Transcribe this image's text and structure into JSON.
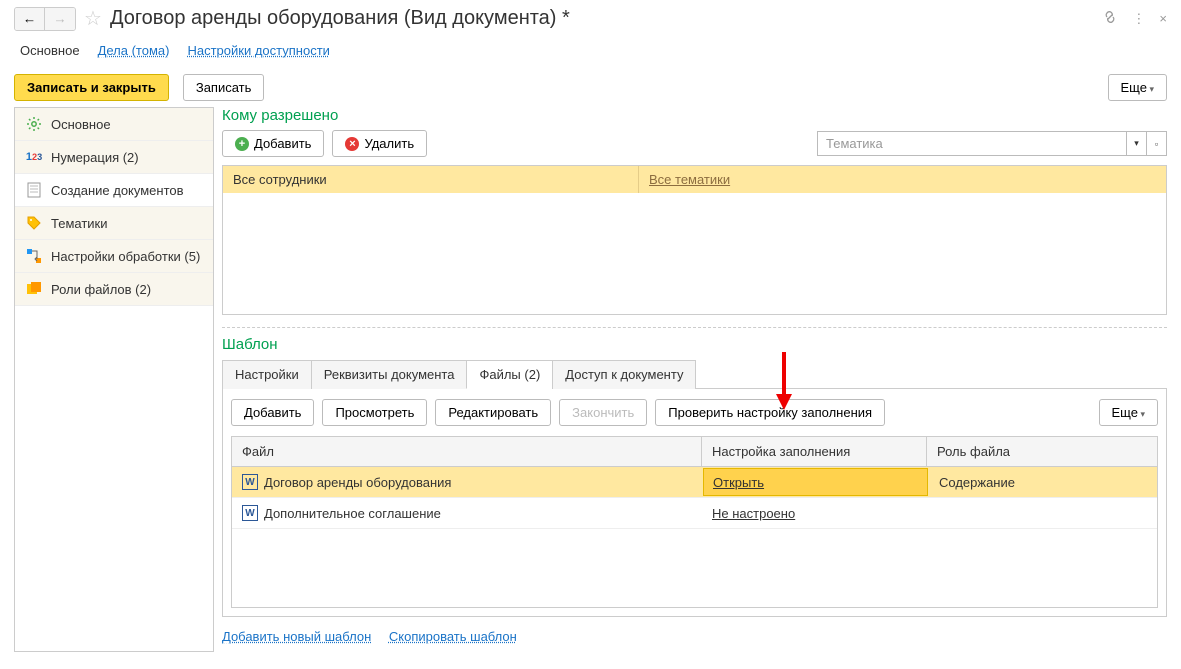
{
  "header": {
    "title": "Договор аренды оборудования (Вид документа) *"
  },
  "headerTabs": {
    "main": "Основное",
    "files": "Дела (тома)",
    "access": "Настройки доступности"
  },
  "toolbar": {
    "saveClose": "Записать и закрыть",
    "save": "Записать",
    "more": "Еще"
  },
  "sidebar": {
    "items": [
      {
        "label": "Основное"
      },
      {
        "label": "Нумерация (2)"
      },
      {
        "label": "Создание документов"
      },
      {
        "label": "Тематики"
      },
      {
        "label": "Настройки обработки (5)"
      },
      {
        "label": "Роли файлов (2)"
      }
    ]
  },
  "permSection": {
    "title": "Кому разрешено",
    "add": "Добавить",
    "delete": "Удалить",
    "thematicPlaceholder": "Тематика",
    "col1": "Все сотрудники",
    "col2": "Все тематики"
  },
  "templateSection": {
    "title": "Шаблон",
    "tabs": {
      "settings": "Настройки",
      "requisites": "Реквизиты документа",
      "files": "Файлы (2)",
      "access": "Доступ к документу"
    },
    "toolbar": {
      "add": "Добавить",
      "view": "Просмотреть",
      "edit": "Редактировать",
      "finish": "Закончить",
      "checkFill": "Проверить настройку заполнения",
      "more": "Еще"
    },
    "table": {
      "headers": {
        "file": "Файл",
        "fillSetting": "Настройка заполнения",
        "fileRole": "Роль файла"
      },
      "rows": [
        {
          "file": "Договор аренды оборудования",
          "fill": "Открыть",
          "role": "Содержание"
        },
        {
          "file": "Дополнительное соглашение",
          "fill": "Не настроено",
          "role": ""
        }
      ]
    }
  },
  "footerLinks": {
    "addTemplate": "Добавить новый шаблон",
    "copyTemplate": "Скопировать шаблон"
  }
}
